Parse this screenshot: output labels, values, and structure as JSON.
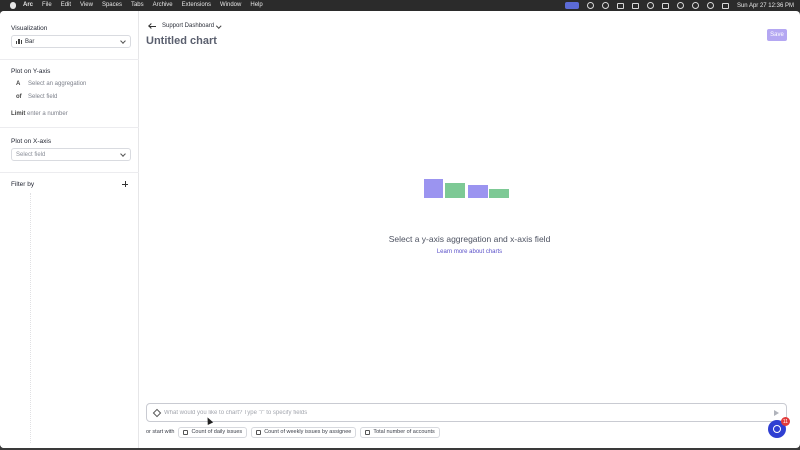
{
  "menubar": {
    "app_name": "Arc",
    "items": [
      "File",
      "Edit",
      "View",
      "Spaces",
      "Tabs",
      "Archive",
      "Extensions",
      "Window",
      "Help"
    ],
    "clock": "Sun Apr 27  12:36 PM"
  },
  "sidebar": {
    "visualization_label": "Visualization",
    "visualization_value": "Bar",
    "y_axis_label": "Plot on Y-axis",
    "aggregation_letter": "A",
    "aggregation_placeholder": "Select an aggregation",
    "of_label": "of",
    "field_placeholder": "Select field",
    "limit_label": "Limit",
    "limit_placeholder": "enter a number",
    "x_axis_label": "Plot on X-axis",
    "x_field_placeholder": "Select field",
    "filter_label": "Filter by"
  },
  "header": {
    "breadcrumb": "Support Dashboard",
    "title": "Untitled chart",
    "save_label": "Save"
  },
  "empty_state": {
    "message": "Select a y-axis aggregation and x-axis field",
    "link": "Learn more about charts",
    "colors": {
      "purple": "#9b94f0",
      "green": "#7dc995"
    }
  },
  "prompt": {
    "placeholder": "What would you like to chart? Type \"/\" to specify fields"
  },
  "starters": {
    "lead": "or start with",
    "chips": [
      "Count of daily issues",
      "Count of weekly issues by assignee",
      "Total number of accounts"
    ]
  },
  "chat": {
    "badge_count": "11"
  }
}
